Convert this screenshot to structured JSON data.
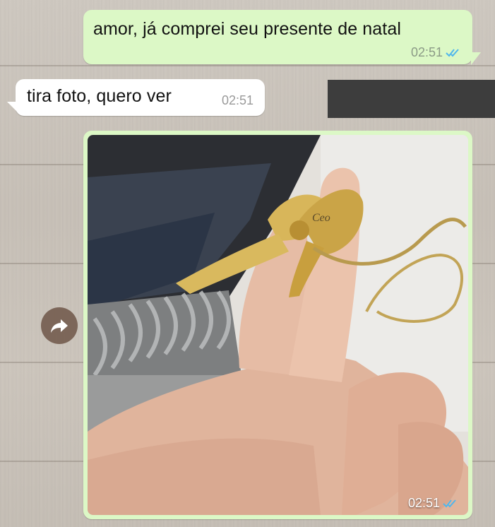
{
  "messages": [
    {
      "direction": "outgoing",
      "text": "amor, já comprei seu presente de natal",
      "time": "02:51",
      "status": "read"
    },
    {
      "direction": "incoming",
      "text": "tira foto, quero ver",
      "time": "02:51"
    },
    {
      "direction": "outgoing",
      "type": "photo",
      "photo_description_icon": "gift-ribbon-photo",
      "time": "02:51",
      "status": "read"
    }
  ],
  "colors": {
    "outgoing_bubble": "#dcf8c6",
    "incoming_bubble": "#ffffff",
    "read_ticks": "#4fb6ec",
    "redaction": "#3d3d3d",
    "forward_button": "#6e5648"
  },
  "icons": {
    "read_receipt": "double-check-icon",
    "forward": "forward-arrow-icon"
  }
}
